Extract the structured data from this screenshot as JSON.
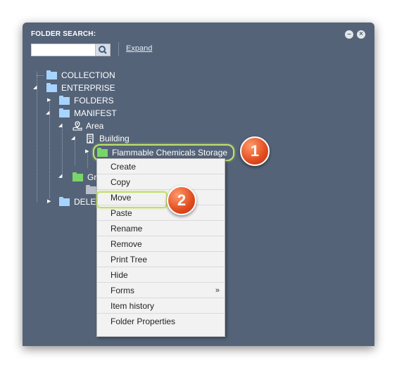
{
  "header": {
    "search_label": "FOLDER SEARCH:",
    "search_value": "",
    "expand_link": "Expand",
    "collapse_icon": "minus-circle-icon",
    "close_icon": "close-circle-icon"
  },
  "tree": {
    "collection": "COLLECTION",
    "enterprise": "ENTERPRISE",
    "folders": "FOLDERS",
    "manifest": "MANIFEST",
    "area": "Area",
    "building": "Building",
    "selected": "Flammable Chemicals Storage",
    "group_partial": "Gr",
    "deleted_partial": "DELE"
  },
  "context_menu": {
    "items": [
      "Create",
      "Copy",
      "Move",
      "Paste",
      "Rename",
      "Remove",
      "Print Tree",
      "Hide",
      "Forms",
      "Item history",
      "Folder Properties"
    ],
    "submenu_arrow": "»"
  },
  "callouts": {
    "one": "1",
    "two": "2"
  },
  "colors": {
    "panel": "#546378",
    "highlight": "#c2e06b",
    "badge": "#e24b1e",
    "folder_blue": "#a7d4ff",
    "folder_green": "#7bd46a"
  }
}
